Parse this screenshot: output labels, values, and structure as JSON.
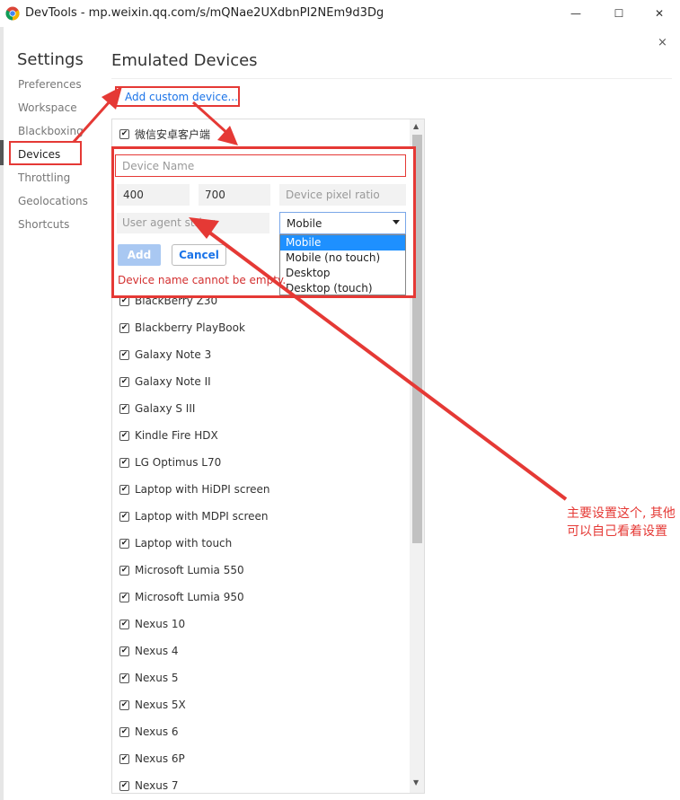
{
  "window": {
    "title": "DevTools - mp.weixin.qq.com/s/mQNae2UXdbnPI2NEm9d3Dg",
    "minimize_glyph": "—",
    "maximize_glyph": "☐",
    "close_glyph": "✕"
  },
  "dialog": {
    "close_glyph": "×"
  },
  "sidebar": {
    "heading": "Settings",
    "items": [
      {
        "label": "Preferences"
      },
      {
        "label": "Workspace"
      },
      {
        "label": "Blackboxing"
      },
      {
        "label": "Devices",
        "active": true
      },
      {
        "label": "Throttling"
      },
      {
        "label": "Geolocations"
      },
      {
        "label": "Shortcuts"
      }
    ]
  },
  "main": {
    "heading": "Emulated Devices",
    "add_custom_label": "Add custom device..."
  },
  "editor": {
    "existing_device": "微信安卓客户端",
    "name_placeholder": "Device Name",
    "width_value": "400",
    "height_value": "700",
    "dpr_placeholder": "Device pixel ratio",
    "ua_placeholder": "User agent string",
    "type_selected": "Mobile",
    "type_options": [
      "Mobile",
      "Mobile (no touch)",
      "Desktop",
      "Desktop (touch)"
    ],
    "add_label": "Add",
    "cancel_label": "Cancel",
    "error": "Device name cannot be empty."
  },
  "devices": [
    "BlackBerry Z30",
    "Blackberry PlayBook",
    "Galaxy Note 3",
    "Galaxy Note II",
    "Galaxy S III",
    "Kindle Fire HDX",
    "LG Optimus L70",
    "Laptop with HiDPI screen",
    "Laptop with MDPI screen",
    "Laptop with touch",
    "Microsoft Lumia 550",
    "Microsoft Lumia 950",
    "Nexus 10",
    "Nexus 4",
    "Nexus 5",
    "Nexus 5X",
    "Nexus 6",
    "Nexus 6P",
    "Nexus 7"
  ],
  "checkbox_glyph": "✔",
  "annotation": {
    "text": "主要设置这个, 其他可以自己看着设置",
    "color": "#e53935"
  }
}
